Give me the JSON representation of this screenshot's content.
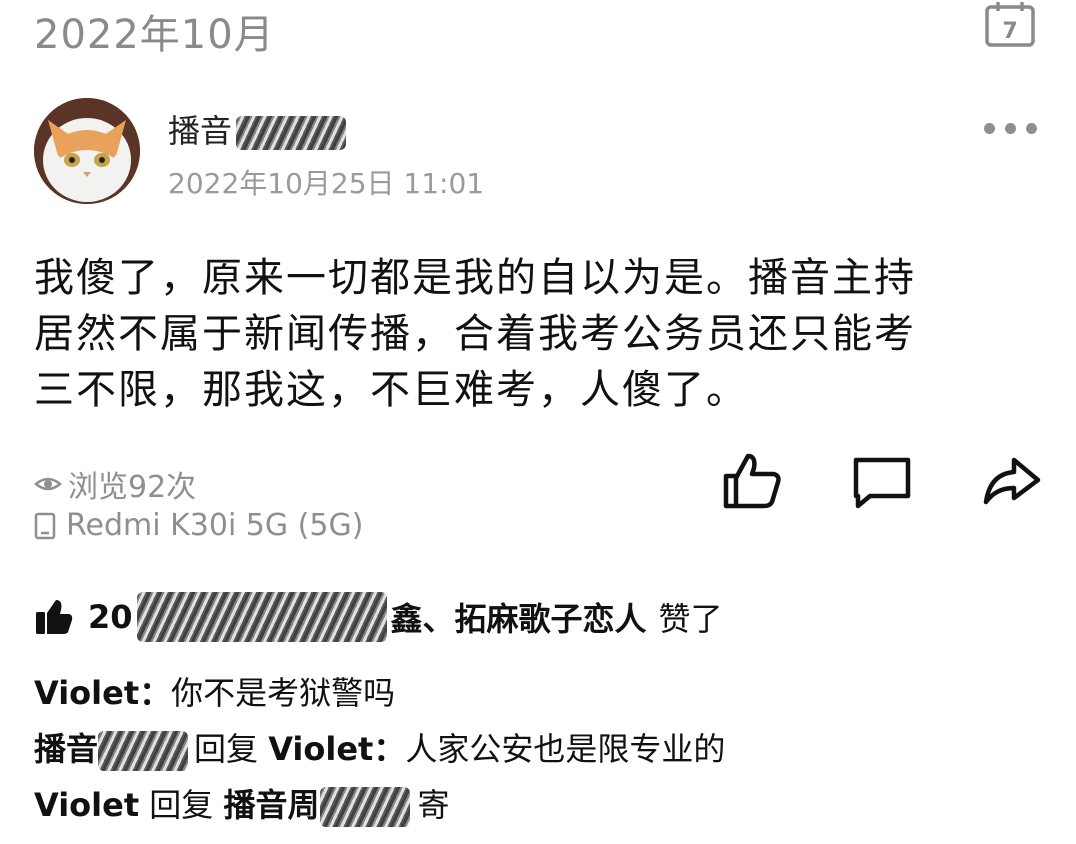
{
  "header": {
    "month": "2022年10月",
    "calendar_day": "7"
  },
  "post": {
    "author": "播音",
    "timestamp": "2022年10月25日 11:01",
    "content_lines": [
      "我傻了，原来一切都是我的自以为是。播音主持",
      "居然不属于新闻传播，合着我考公务员还只能考",
      "三不限，那我这，不巨难考，人傻了。"
    ],
    "views": "浏览92次",
    "device": "Redmi K30i 5G (5G)"
  },
  "likes": {
    "prefix": "20",
    "suffix_name": "鑫、拓麻歌子恋人",
    "suffix_text": "赞了"
  },
  "comments": [
    {
      "author": "Violet",
      "sep": "：",
      "text": "你不是考狱警吗"
    },
    {
      "author": "播音",
      "reply_word": "回复",
      "reply_to": "Violet",
      "sep": "：",
      "text": "人家公安也是限专业的"
    },
    {
      "author": "Violet",
      "reply_word": "回复",
      "reply_to": "播音周",
      "text": "寄"
    }
  ],
  "icons": [
    "calendar-icon",
    "more-icon",
    "eye-icon",
    "phone-icon",
    "thumbs-up-icon",
    "comment-icon",
    "share-icon",
    "like-filled-icon"
  ],
  "colors": {
    "muted": "#8f8f8f",
    "text": "#111111",
    "background": "#ffffff"
  }
}
